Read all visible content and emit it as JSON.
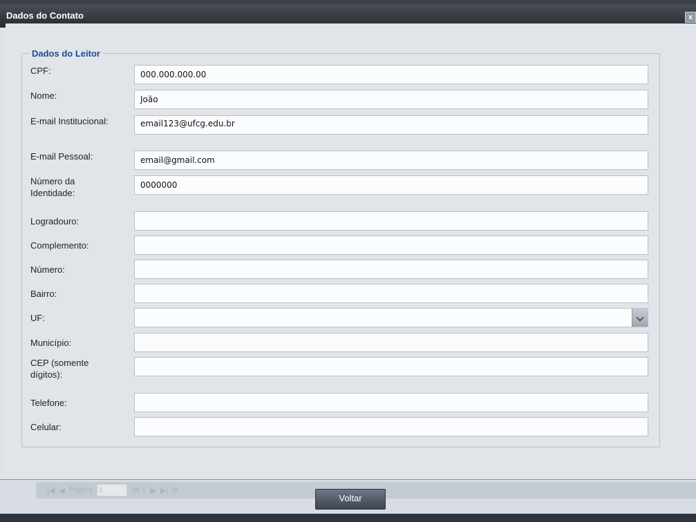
{
  "window": {
    "title": "Dados do Contato",
    "close_symbol": "x"
  },
  "group": {
    "legend": "Dados do Leitor"
  },
  "fields": [
    {
      "label": "CPF:",
      "value": "000.000.000.00"
    },
    {
      "label": "Nome:",
      "value": " João"
    },
    {
      "label": "E-mail Institucional:",
      "value": "email123@ufcg.edu.br"
    },
    {
      "label": "E-mail Pessoal:",
      "value": "email@gmail.com"
    },
    {
      "label": "Número da Identidade:",
      "value": "0000000"
    },
    {
      "label": "Logradouro:",
      "value": ""
    },
    {
      "label": "Complemento:",
      "value": ""
    },
    {
      "label": "Número:",
      "value": ""
    },
    {
      "label": "Bairro:",
      "value": ""
    },
    {
      "label": "UF:",
      "value": ""
    },
    {
      "label": "Município:",
      "value": ""
    },
    {
      "label": "CEP (somente dígitos):",
      "value": ""
    },
    {
      "label": "Telefone:",
      "value": ""
    },
    {
      "label": "Celular:",
      "value": ""
    }
  ],
  "buttons": {
    "back_label": "Voltar"
  },
  "background": {
    "pager_page_label": "Página",
    "pager_page_value": "1",
    "pager_of_label": "de 1"
  }
}
